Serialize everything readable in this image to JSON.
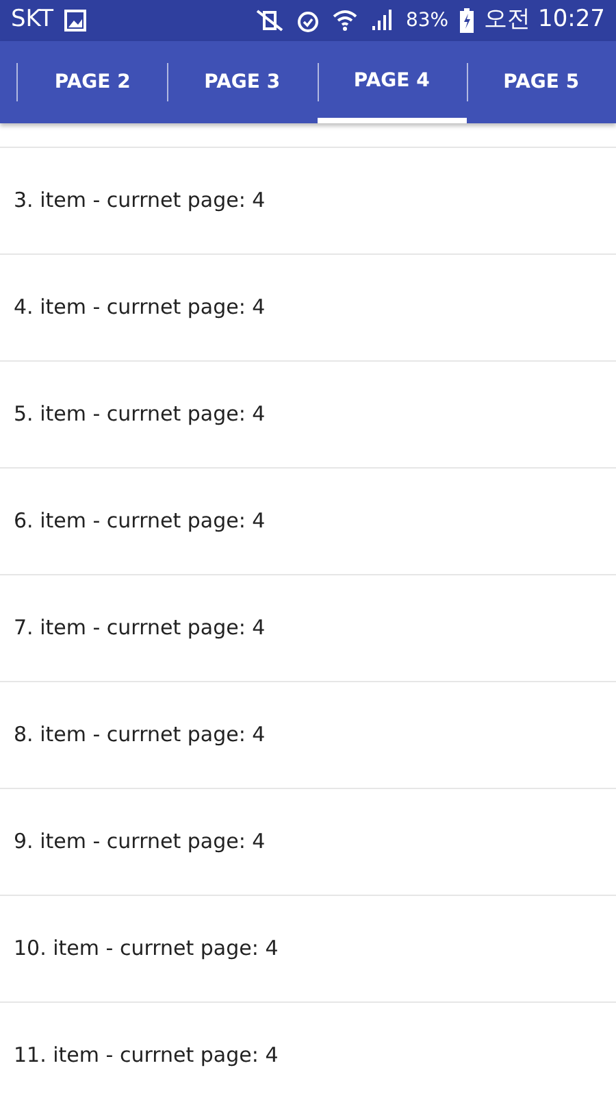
{
  "status_bar": {
    "carrier": "SKT",
    "battery": "83%",
    "time": "오전 10:27"
  },
  "tabs": [
    {
      "label": "PAGE 2",
      "selected": false
    },
    {
      "label": "PAGE 3",
      "selected": false
    },
    {
      "label": "PAGE 4",
      "selected": true
    },
    {
      "label": "PAGE 5",
      "selected": false
    }
  ],
  "items": [
    "3. item - currnet page: 4",
    "4. item - currnet page: 4",
    "5. item - currnet page: 4",
    "6. item - currnet page: 4",
    "7. item - currnet page: 4",
    "8. item - currnet page: 4",
    "9. item - currnet page: 4",
    "10. item - currnet page: 4",
    "11. item - currnet page: 4"
  ]
}
